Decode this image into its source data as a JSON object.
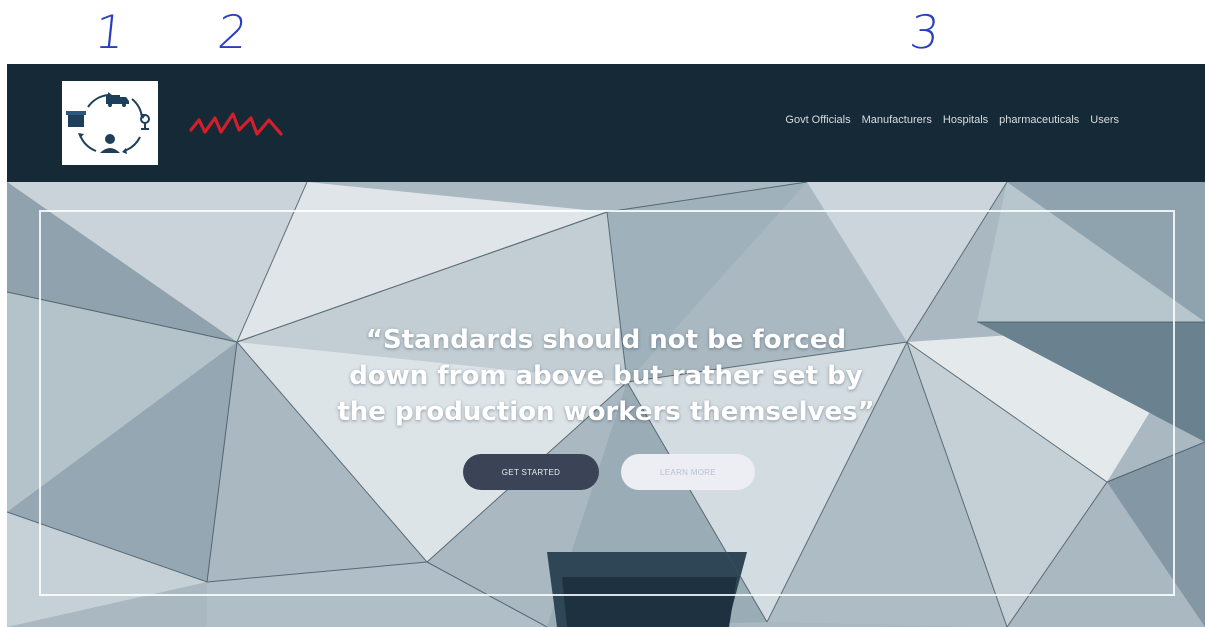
{
  "annotations": [
    "1",
    "2",
    "3"
  ],
  "navbar": {
    "logo_icon": "supply-chain-logo-icon",
    "signature_icon": "red-scribble-signature",
    "links": [
      "Govt Officials",
      "Manufacturers",
      "Hospitals",
      "pharmaceuticals",
      "Users"
    ]
  },
  "hero": {
    "quote": "“Standards should not be forced\ndown from above but rather set by\nthe production workers themselves”",
    "primary_button": "GET STARTED",
    "secondary_button": "LEARN MORE"
  },
  "colors": {
    "navbar_bg": "#162937",
    "annotation_ink": "#2a3fbf",
    "signature_red": "#d21f2a",
    "primary_button_bg": "#3a4456",
    "secondary_button_bg": "#eceef4"
  }
}
